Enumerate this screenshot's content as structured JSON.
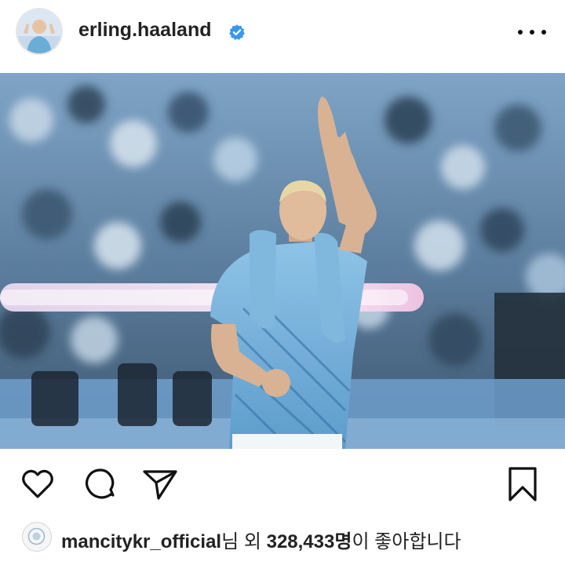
{
  "header": {
    "username": "erling.haaland",
    "verified_icon": "verified-badge-icon",
    "more_icon": "more-options-icon",
    "avatar_icon": "profile-avatar"
  },
  "post": {
    "image_alt": "Player in light blue warm-up shirt waving to the crowd in a stadium"
  },
  "actions": {
    "like_icon": "heart-icon",
    "comment_icon": "comment-icon",
    "share_icon": "send-icon",
    "save_icon": "bookmark-icon"
  },
  "likes": {
    "liker": "mancitykr_official",
    "liker_suffix": "님 외 ",
    "count": "328,433명",
    "tail": "이 좋아합니다"
  },
  "colors": {
    "verified_blue": "#3897f0",
    "text": "#222222",
    "shirt_blue": "#6aaed6"
  }
}
